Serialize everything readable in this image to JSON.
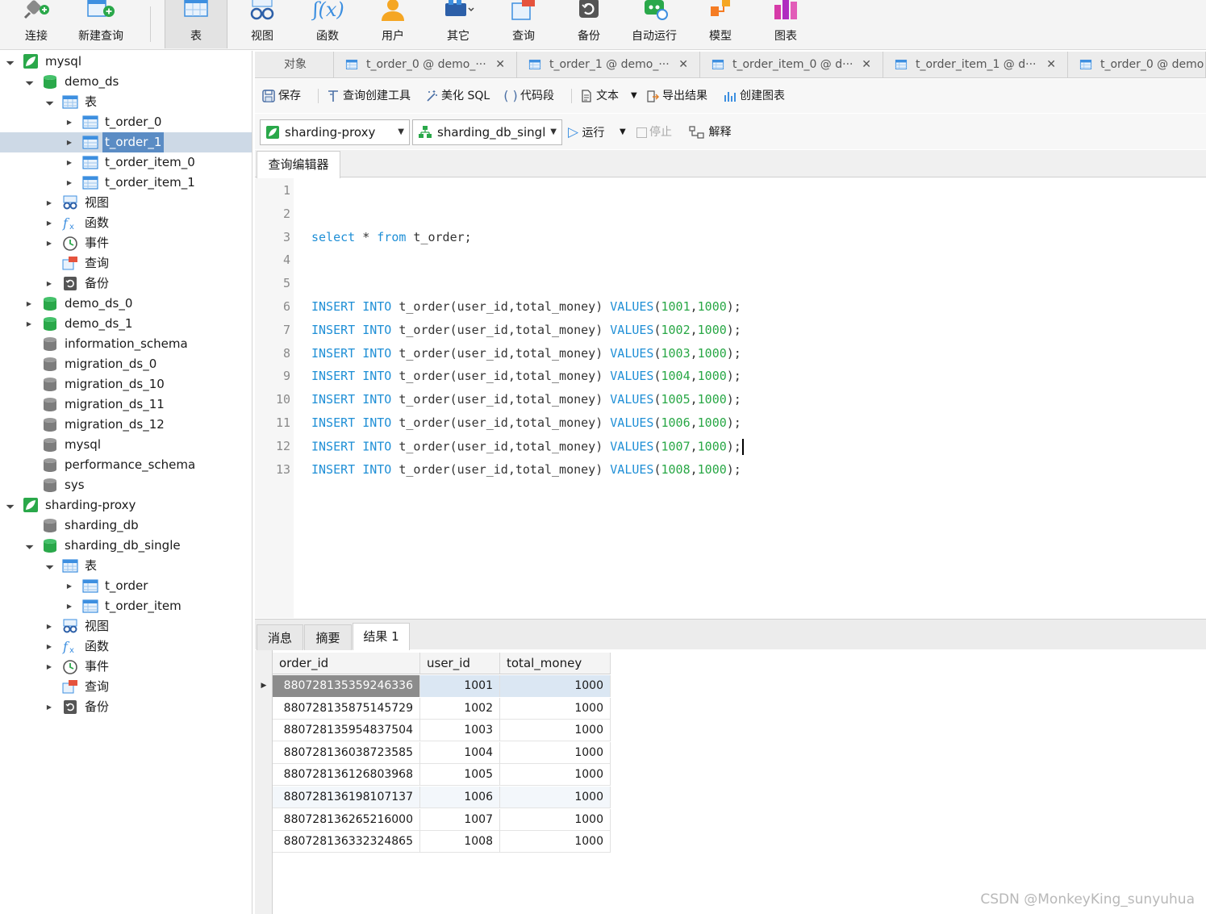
{
  "toolbar": {
    "items": [
      {
        "label": "连接",
        "icon": "plug-icon"
      },
      {
        "label": "新建查询",
        "icon": "new-query-icon"
      },
      {
        "label": "表",
        "icon": "table-icon"
      },
      {
        "label": "视图",
        "icon": "view-icon"
      },
      {
        "label": "函数",
        "icon": "function-icon"
      },
      {
        "label": "用户",
        "icon": "user-icon"
      },
      {
        "label": "其它",
        "icon": "other-icon"
      },
      {
        "label": "查询",
        "icon": "query-icon"
      },
      {
        "label": "备份",
        "icon": "backup-icon"
      },
      {
        "label": "自动运行",
        "icon": "auto-run-icon"
      },
      {
        "label": "模型",
        "icon": "model-icon"
      },
      {
        "label": "图表",
        "icon": "chart-icon"
      }
    ],
    "active": "表"
  },
  "sidebar": {
    "nodes": [
      {
        "label": "mysql",
        "type": "connection",
        "level": 0,
        "arrow": "open"
      },
      {
        "label": "demo_ds",
        "type": "db-green",
        "level": 1,
        "arrow": "open"
      },
      {
        "label": "表",
        "type": "tables",
        "level": 2,
        "arrow": "open"
      },
      {
        "label": "t_order_0",
        "type": "table",
        "level": 3,
        "arrow": "closed"
      },
      {
        "label": "t_order_1",
        "type": "table",
        "level": 3,
        "arrow": "closed",
        "selected": true
      },
      {
        "label": "t_order_item_0",
        "type": "table",
        "level": 3,
        "arrow": "closed"
      },
      {
        "label": "t_order_item_1",
        "type": "table",
        "level": 3,
        "arrow": "closed"
      },
      {
        "label": "视图",
        "type": "views",
        "level": 2,
        "arrow": "closed"
      },
      {
        "label": "函数",
        "type": "functions",
        "level": 2,
        "arrow": "closed"
      },
      {
        "label": "事件",
        "type": "events",
        "level": 2,
        "arrow": "closed"
      },
      {
        "label": "查询",
        "type": "queries",
        "level": 2,
        "arrow": "none"
      },
      {
        "label": "备份",
        "type": "backups",
        "level": 2,
        "arrow": "closed"
      },
      {
        "label": "demo_ds_0",
        "type": "db-green",
        "level": 1,
        "arrow": "closed"
      },
      {
        "label": "demo_ds_1",
        "type": "db-green",
        "level": 1,
        "arrow": "closed"
      },
      {
        "label": "information_schema",
        "type": "db-grey",
        "level": 1,
        "arrow": "none"
      },
      {
        "label": "migration_ds_0",
        "type": "db-grey",
        "level": 1,
        "arrow": "none"
      },
      {
        "label": "migration_ds_10",
        "type": "db-grey",
        "level": 1,
        "arrow": "none"
      },
      {
        "label": "migration_ds_11",
        "type": "db-grey",
        "level": 1,
        "arrow": "none"
      },
      {
        "label": "migration_ds_12",
        "type": "db-grey",
        "level": 1,
        "arrow": "none"
      },
      {
        "label": "mysql",
        "type": "db-grey",
        "level": 1,
        "arrow": "none"
      },
      {
        "label": "performance_schema",
        "type": "db-grey",
        "level": 1,
        "arrow": "none"
      },
      {
        "label": "sys",
        "type": "db-grey",
        "level": 1,
        "arrow": "none"
      },
      {
        "label": "sharding-proxy",
        "type": "connection",
        "level": 0,
        "arrow": "open"
      },
      {
        "label": "sharding_db",
        "type": "db-grey",
        "level": 1,
        "arrow": "none"
      },
      {
        "label": "sharding_db_single",
        "type": "db-green",
        "level": 1,
        "arrow": "open"
      },
      {
        "label": "表",
        "type": "tables",
        "level": 2,
        "arrow": "open"
      },
      {
        "label": "t_order",
        "type": "table",
        "level": 3,
        "arrow": "closed"
      },
      {
        "label": "t_order_item",
        "type": "table",
        "level": 3,
        "arrow": "closed"
      },
      {
        "label": "视图",
        "type": "views",
        "level": 2,
        "arrow": "closed"
      },
      {
        "label": "函数",
        "type": "functions",
        "level": 2,
        "arrow": "closed"
      },
      {
        "label": "事件",
        "type": "events",
        "level": 2,
        "arrow": "closed"
      },
      {
        "label": "查询",
        "type": "queries",
        "level": 2,
        "arrow": "none"
      },
      {
        "label": "备份",
        "type": "backups",
        "level": 2,
        "arrow": "closed"
      }
    ]
  },
  "tabs": [
    {
      "label": "对象",
      "closable": false
    },
    {
      "label": "t_order_0 @ demo_···",
      "closable": true
    },
    {
      "label": "t_order_1 @ demo_···",
      "closable": true
    },
    {
      "label": "t_order_item_0 @ d···",
      "closable": true
    },
    {
      "label": "t_order_item_1 @ d···",
      "closable": true
    },
    {
      "label": "t_order_0 @ demo",
      "closable": false
    }
  ],
  "tab_close_glyph": "✕",
  "query_toolbar": {
    "save": "保存",
    "query_builder": "查询创建工具",
    "beautify": "美化 SQL",
    "snippet": "代码段",
    "text": "文本",
    "export": "导出结果",
    "create_chart": "创建图表"
  },
  "run_bar": {
    "connection": "sharding-proxy",
    "database": "sharding_db_singl",
    "run": "运行",
    "stop": "停止",
    "explain": "解释"
  },
  "editor_tab": "查询编辑器",
  "code_lines": [
    {
      "n": "1",
      "tokens": []
    },
    {
      "n": "2",
      "tokens": []
    },
    {
      "n": "3",
      "tokens": [
        {
          "t": "select",
          "c": "kw"
        },
        {
          "t": " * ",
          "c": ""
        },
        {
          "t": "from",
          "c": "kw"
        },
        {
          "t": " t_order;",
          "c": ""
        }
      ]
    },
    {
      "n": "4",
      "tokens": []
    },
    {
      "n": "5",
      "tokens": []
    },
    {
      "n": "6",
      "tokens": [
        {
          "t": "INSERT",
          "c": "kw"
        },
        {
          "t": " ",
          "c": ""
        },
        {
          "t": "INTO",
          "c": "kw"
        },
        {
          "t": " t_order(user_id,total_money) ",
          "c": ""
        },
        {
          "t": "VALUES",
          "c": "kw"
        },
        {
          "t": "(",
          "c": ""
        },
        {
          "t": "1001",
          "c": "num"
        },
        {
          "t": ",",
          "c": ""
        },
        {
          "t": "1000",
          "c": "num"
        },
        {
          "t": ");",
          "c": ""
        }
      ]
    },
    {
      "n": "7",
      "tokens": [
        {
          "t": "INSERT",
          "c": "kw"
        },
        {
          "t": " ",
          "c": ""
        },
        {
          "t": "INTO",
          "c": "kw"
        },
        {
          "t": " t_order(user_id,total_money) ",
          "c": ""
        },
        {
          "t": "VALUES",
          "c": "kw"
        },
        {
          "t": "(",
          "c": ""
        },
        {
          "t": "1002",
          "c": "num"
        },
        {
          "t": ",",
          "c": ""
        },
        {
          "t": "1000",
          "c": "num"
        },
        {
          "t": ");",
          "c": ""
        }
      ]
    },
    {
      "n": "8",
      "tokens": [
        {
          "t": "INSERT",
          "c": "kw"
        },
        {
          "t": " ",
          "c": ""
        },
        {
          "t": "INTO",
          "c": "kw"
        },
        {
          "t": " t_order(user_id,total_money) ",
          "c": ""
        },
        {
          "t": "VALUES",
          "c": "kw"
        },
        {
          "t": "(",
          "c": ""
        },
        {
          "t": "1003",
          "c": "num"
        },
        {
          "t": ",",
          "c": ""
        },
        {
          "t": "1000",
          "c": "num"
        },
        {
          "t": ");",
          "c": ""
        }
      ]
    },
    {
      "n": "9",
      "tokens": [
        {
          "t": "INSERT",
          "c": "kw"
        },
        {
          "t": " ",
          "c": ""
        },
        {
          "t": "INTO",
          "c": "kw"
        },
        {
          "t": " t_order(user_id,total_money) ",
          "c": ""
        },
        {
          "t": "VALUES",
          "c": "kw"
        },
        {
          "t": "(",
          "c": ""
        },
        {
          "t": "1004",
          "c": "num"
        },
        {
          "t": ",",
          "c": ""
        },
        {
          "t": "1000",
          "c": "num"
        },
        {
          "t": ");",
          "c": ""
        }
      ]
    },
    {
      "n": "10",
      "tokens": [
        {
          "t": "INSERT",
          "c": "kw"
        },
        {
          "t": " ",
          "c": ""
        },
        {
          "t": "INTO",
          "c": "kw"
        },
        {
          "t": " t_order(user_id,total_money) ",
          "c": ""
        },
        {
          "t": "VALUES",
          "c": "kw"
        },
        {
          "t": "(",
          "c": ""
        },
        {
          "t": "1005",
          "c": "num"
        },
        {
          "t": ",",
          "c": ""
        },
        {
          "t": "1000",
          "c": "num"
        },
        {
          "t": ");",
          "c": ""
        }
      ]
    },
    {
      "n": "11",
      "tokens": [
        {
          "t": "INSERT",
          "c": "kw"
        },
        {
          "t": " ",
          "c": ""
        },
        {
          "t": "INTO",
          "c": "kw"
        },
        {
          "t": " t_order(user_id,total_money) ",
          "c": ""
        },
        {
          "t": "VALUES",
          "c": "kw"
        },
        {
          "t": "(",
          "c": ""
        },
        {
          "t": "1006",
          "c": "num"
        },
        {
          "t": ",",
          "c": ""
        },
        {
          "t": "1000",
          "c": "num"
        },
        {
          "t": ");",
          "c": ""
        }
      ]
    },
    {
      "n": "12",
      "tokens": [
        {
          "t": "INSERT",
          "c": "kw"
        },
        {
          "t": " ",
          "c": ""
        },
        {
          "t": "INTO",
          "c": "kw"
        },
        {
          "t": " t_order(user_id,total_money) ",
          "c": ""
        },
        {
          "t": "VALUES",
          "c": "kw"
        },
        {
          "t": "(",
          "c": ""
        },
        {
          "t": "1007",
          "c": "num"
        },
        {
          "t": ",",
          "c": ""
        },
        {
          "t": "1000",
          "c": "num"
        },
        {
          "t": ");",
          "c": ""
        }
      ],
      "caret": true
    },
    {
      "n": "13",
      "tokens": [
        {
          "t": "INSERT",
          "c": "kw"
        },
        {
          "t": " ",
          "c": ""
        },
        {
          "t": "INTO",
          "c": "kw"
        },
        {
          "t": " t_order(user_id,total_money) ",
          "c": ""
        },
        {
          "t": "VALUES",
          "c": "kw"
        },
        {
          "t": "(",
          "c": ""
        },
        {
          "t": "1008",
          "c": "num"
        },
        {
          "t": ",",
          "c": ""
        },
        {
          "t": "1000",
          "c": "num"
        },
        {
          "t": ");",
          "c": ""
        }
      ]
    }
  ],
  "result_tabs": [
    {
      "label": "消息",
      "active": false
    },
    {
      "label": "摘要",
      "active": false
    },
    {
      "label": "结果 1",
      "active": true
    }
  ],
  "result_grid": {
    "columns": [
      "order_id",
      "user_id",
      "total_money"
    ],
    "rows": [
      [
        "880728135359246336",
        "1001",
        "1000"
      ],
      [
        "880728135875145729",
        "1002",
        "1000"
      ],
      [
        "880728135954837504",
        "1003",
        "1000"
      ],
      [
        "880728136038723585",
        "1004",
        "1000"
      ],
      [
        "880728136126803968",
        "1005",
        "1000"
      ],
      [
        "880728136198107137",
        "1006",
        "1000"
      ],
      [
        "880728136265216000",
        "1007",
        "1000"
      ],
      [
        "880728136332324865",
        "1008",
        "1000"
      ]
    ],
    "selected_row": 0,
    "row_marker_glyph": "▶"
  },
  "watermark": "CSDN @MonkeyKing_sunyuhua",
  "colors": {
    "keyword": "#1f8fd6",
    "number": "#28a745",
    "selection": "#5b8cc4",
    "db_green": "#2aa84a",
    "table_blue": "#3d8fe0"
  }
}
